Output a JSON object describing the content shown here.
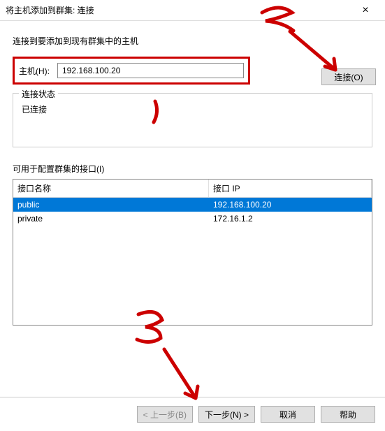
{
  "window": {
    "title": "将主机添加到群集: 连接"
  },
  "description": "连接到要添加到现有群集中的主机",
  "host": {
    "label": "主机(H):",
    "value": "192.168.100.20"
  },
  "connect_button": "连接(O)",
  "status_group": {
    "legend": "连接状态",
    "text": "已连接"
  },
  "interfaces": {
    "label": "可用于配置群集的接口(I)",
    "columns": {
      "name": "接口名称",
      "ip": "接口 IP"
    },
    "rows": [
      {
        "name": "public",
        "ip": "192.168.100.20",
        "selected": true
      },
      {
        "name": "private",
        "ip": "172.16.1.2",
        "selected": false
      }
    ]
  },
  "footer": {
    "back": "< 上一步(B)",
    "next": "下一步(N) >",
    "cancel": "取消",
    "help": "帮助"
  },
  "annotation_color": "#cc0000"
}
